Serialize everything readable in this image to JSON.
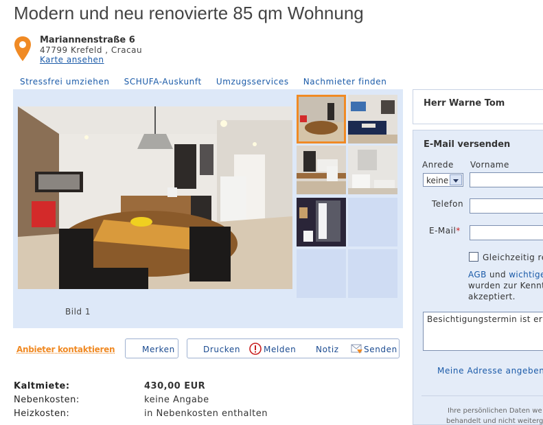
{
  "listing": {
    "title": "Modern und neu renovierte 85 qm Wohnung",
    "street": "Mariannenstraße 6",
    "city_line": "47799 Krefeld , Cracau",
    "map_link": "Karte ansehen"
  },
  "services": [
    "Stressfrei umziehen",
    "SCHUFA-Auskunft",
    "Umzugsservices",
    "Nachmieter finden"
  ],
  "gallery": {
    "caption": "Bild 1",
    "thumbnail_count": 5,
    "selected_thumbnail": 1
  },
  "actions": {
    "contact": "Anbieter kontaktieren",
    "remember": "Merken",
    "print": "Drucken",
    "report": "Melden",
    "note": "Notiz",
    "send": "Senden"
  },
  "facts": [
    {
      "label": "Kaltmiete:",
      "value": "430,00 EUR"
    },
    {
      "label": "Nebenkosten:",
      "value": "keine Angabe"
    },
    {
      "label": "Heizkosten:",
      "value": "in Nebenkosten enthalten"
    }
  ],
  "contact_panel": {
    "provider_name": "Herr Warne Tom",
    "form_title": "E-Mail versenden",
    "salutation_label": "Anrede",
    "salutation_value": "keine",
    "firstname_label": "Vorname",
    "phone_label": "Telefon",
    "email_label": "E-Mail",
    "required_marker": "*",
    "checkbox_label": "Gleichzeitig re",
    "terms_link1": "AGB",
    "terms_and": " und ",
    "terms_link2": "wichtige",
    "terms_line2": "wurden zur Kenntn",
    "terms_line3": "akzeptiert.",
    "message_text": "Besichtigungstermin ist erw",
    "address_link": "Meine Adresse angeben",
    "footer_text1": "Ihre persönlichen Daten we",
    "footer_text2": "behandelt und nicht weitergeg"
  },
  "colors": {
    "accent_orange": "#f08a24",
    "link_blue": "#1a5aa8",
    "panel_blue": "#dde8f8"
  }
}
